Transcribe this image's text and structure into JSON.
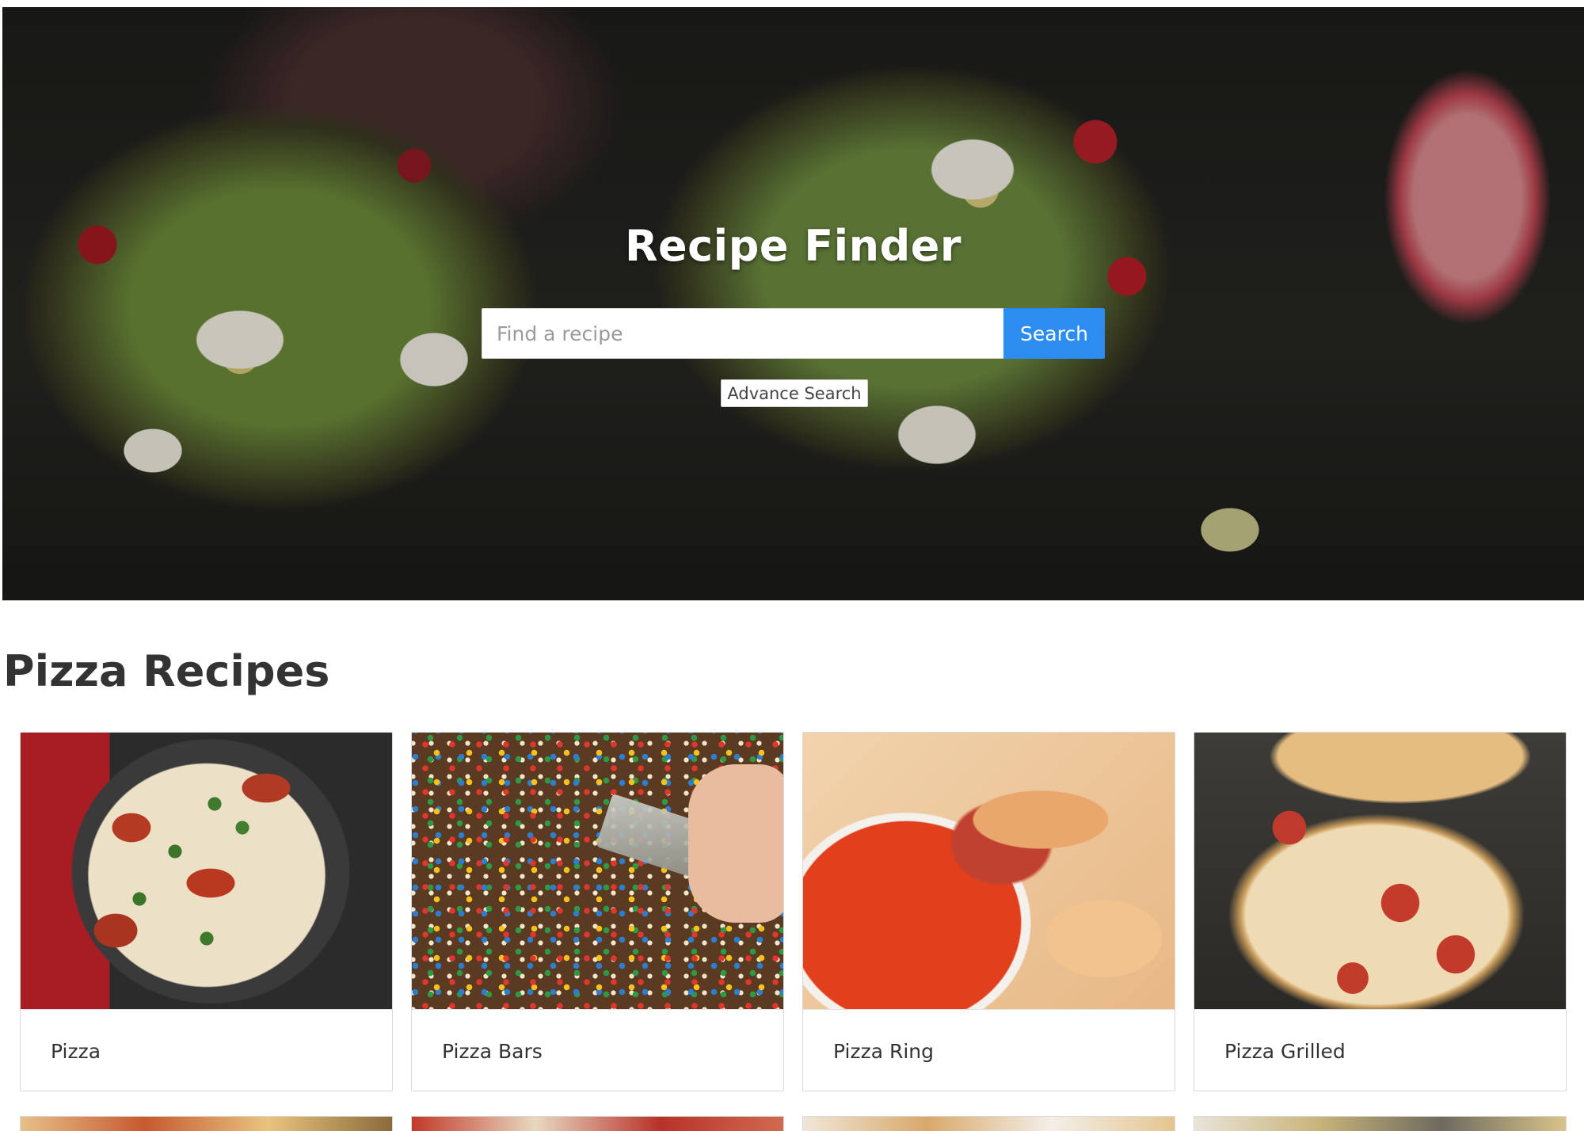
{
  "hero": {
    "title": "Recipe Finder",
    "search": {
      "placeholder": "Find a recipe",
      "button_label": "Search"
    },
    "advance_search_label": "Advance Search"
  },
  "section": {
    "title": "Pizza Recipes"
  },
  "recipes": [
    {
      "name": "Pizza"
    },
    {
      "name": "Pizza Bars"
    },
    {
      "name": "Pizza Ring"
    },
    {
      "name": "Pizza Grilled"
    }
  ],
  "colors": {
    "accent": "#2d8cf0",
    "text": "#333333",
    "border": "#d9d9d9"
  }
}
